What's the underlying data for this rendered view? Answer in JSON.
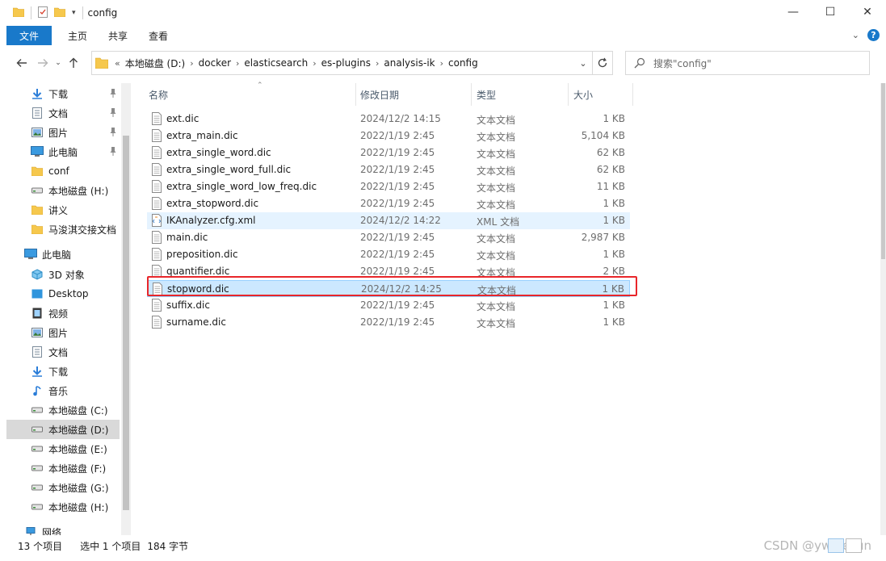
{
  "window": {
    "title": "config",
    "controls": {
      "minimize": "—",
      "maximize": "☐",
      "close": "✕"
    }
  },
  "ribbon": {
    "tabs": [
      "文件",
      "主页",
      "共享",
      "查看"
    ],
    "help": "?"
  },
  "address": {
    "prefix": "«",
    "crumbs": [
      "本地磁盘 (D:)",
      "docker",
      "elasticsearch",
      "es-plugins",
      "analysis-ik",
      "config"
    ],
    "separator": "›",
    "search_placeholder": "搜索\"config\""
  },
  "sidebar": {
    "items": [
      {
        "label": "下载",
        "icon": "download-icon",
        "pinned": true
      },
      {
        "label": "文档",
        "icon": "document-icon",
        "pinned": true
      },
      {
        "label": "图片",
        "icon": "pictures-icon",
        "pinned": true
      },
      {
        "label": "此电脑",
        "icon": "computer-icon",
        "pinned": true
      },
      {
        "label": "conf",
        "icon": "folder-icon",
        "pinned": false
      },
      {
        "label": "本地磁盘 (H:)",
        "icon": "drive-icon",
        "pinned": false
      },
      {
        "label": "讲义",
        "icon": "folder-icon",
        "pinned": false
      },
      {
        "label": "马浚淇交接文档",
        "icon": "folder-icon",
        "pinned": false
      },
      {
        "label": "此电脑",
        "icon": "computer-icon",
        "pinned": false,
        "root": true
      },
      {
        "label": "3D 对象",
        "icon": "3d-objects-icon",
        "pinned": false
      },
      {
        "label": "Desktop",
        "icon": "desktop-icon",
        "pinned": false
      },
      {
        "label": "视频",
        "icon": "video-icon",
        "pinned": false
      },
      {
        "label": "图片",
        "icon": "pictures-icon",
        "pinned": false
      },
      {
        "label": "文档",
        "icon": "document-icon",
        "pinned": false
      },
      {
        "label": "下载",
        "icon": "download-icon",
        "pinned": false
      },
      {
        "label": "音乐",
        "icon": "music-icon",
        "pinned": false
      },
      {
        "label": "本地磁盘 (C:)",
        "icon": "drive-icon",
        "pinned": false
      },
      {
        "label": "本地磁盘 (D:)",
        "icon": "drive-icon",
        "pinned": false,
        "selected": true
      },
      {
        "label": "本地磁盘 (E:)",
        "icon": "drive-icon",
        "pinned": false
      },
      {
        "label": "本地磁盘 (F:)",
        "icon": "drive-icon",
        "pinned": false
      },
      {
        "label": "本地磁盘 (G:)",
        "icon": "drive-icon",
        "pinned": false
      },
      {
        "label": "本地磁盘 (H:)",
        "icon": "drive-icon",
        "pinned": false
      },
      {
        "label": "网络",
        "icon": "network-icon",
        "pinned": false,
        "root": true
      }
    ]
  },
  "columns": {
    "name": "名称",
    "date": "修改日期",
    "type": "类型",
    "size": "大小"
  },
  "files": [
    {
      "name": "ext.dic",
      "date": "2024/12/2 14:15",
      "type": "文本文档",
      "size": "1 KB"
    },
    {
      "name": "extra_main.dic",
      "date": "2022/1/19 2:45",
      "type": "文本文档",
      "size": "5,104 KB"
    },
    {
      "name": "extra_single_word.dic",
      "date": "2022/1/19 2:45",
      "type": "文本文档",
      "size": "62 KB"
    },
    {
      "name": "extra_single_word_full.dic",
      "date": "2022/1/19 2:45",
      "type": "文本文档",
      "size": "62 KB"
    },
    {
      "name": "extra_single_word_low_freq.dic",
      "date": "2022/1/19 2:45",
      "type": "文本文档",
      "size": "11 KB"
    },
    {
      "name": "extra_stopword.dic",
      "date": "2022/1/19 2:45",
      "type": "文本文档",
      "size": "1 KB"
    },
    {
      "name": "IKAnalyzer.cfg.xml",
      "date": "2024/12/2 14:22",
      "type": "XML 文档",
      "size": "1 KB",
      "state": "hover"
    },
    {
      "name": "main.dic",
      "date": "2022/1/19 2:45",
      "type": "文本文档",
      "size": "2,987 KB"
    },
    {
      "name": "preposition.dic",
      "date": "2022/1/19 2:45",
      "type": "文本文档",
      "size": "1 KB"
    },
    {
      "name": "quantifier.dic",
      "date": "2022/1/19 2:45",
      "type": "文本文档",
      "size": "2 KB"
    },
    {
      "name": "stopword.dic",
      "date": "2024/12/2 14:25",
      "type": "文本文档",
      "size": "1 KB",
      "state": "selected"
    },
    {
      "name": "suffix.dic",
      "date": "2022/1/19 2:45",
      "type": "文本文档",
      "size": "1 KB"
    },
    {
      "name": "surname.dic",
      "date": "2022/1/19 2:45",
      "type": "文本文档",
      "size": "1 KB"
    }
  ],
  "status": {
    "count": "13 个项目",
    "selected": "选中 1 个项目",
    "size": "184 字节"
  },
  "watermark": "CSDN @ywjbesun",
  "colors": {
    "accent": "#1979ca",
    "selection": "#cce8ff",
    "hover": "#e5f3ff",
    "highlight_box": "#e8262a"
  }
}
